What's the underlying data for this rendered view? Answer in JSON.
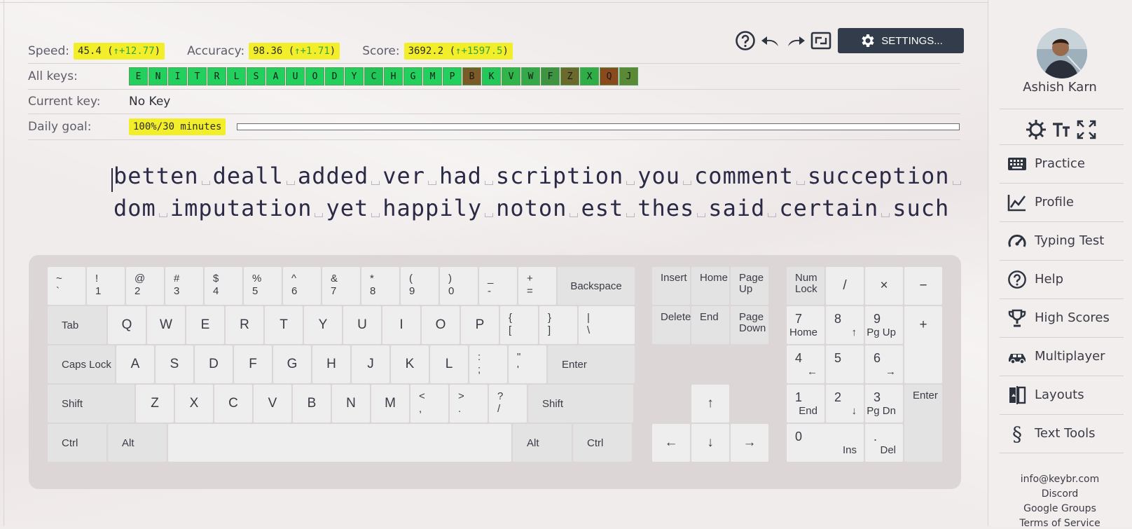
{
  "stats": {
    "speed_label": "Speed:",
    "speed_value": "45.4",
    "speed_delta": "+12.77",
    "accuracy_label": "Accuracy:",
    "accuracy_value": "98.36",
    "accuracy_delta": "+1.71",
    "score_label": "Score:",
    "score_value": "3692.2",
    "score_delta": "+1597.5"
  },
  "toolbar": {
    "help_icon": "help-circle-icon",
    "undo_icon": "undo-icon",
    "redo_icon": "redo-icon",
    "fullscreen_icon": "window-icon",
    "settings_label": "SETTINGS..."
  },
  "all_keys": {
    "label": "All keys:",
    "keys": [
      {
        "k": "E",
        "color": "#22d05e"
      },
      {
        "k": "N",
        "color": "#22d05e"
      },
      {
        "k": "I",
        "color": "#22d05e"
      },
      {
        "k": "T",
        "color": "#22d05e"
      },
      {
        "k": "R",
        "color": "#22d05e"
      },
      {
        "k": "L",
        "color": "#22d05e"
      },
      {
        "k": "S",
        "color": "#22d05e"
      },
      {
        "k": "A",
        "color": "#22d05e"
      },
      {
        "k": "U",
        "color": "#22d05e"
      },
      {
        "k": "O",
        "color": "#22d05e"
      },
      {
        "k": "D",
        "color": "#22d05e"
      },
      {
        "k": "Y",
        "color": "#22d05e"
      },
      {
        "k": "C",
        "color": "#1fc556"
      },
      {
        "k": "H",
        "color": "#22cf5a"
      },
      {
        "k": "G",
        "color": "#22d05e"
      },
      {
        "k": "M",
        "color": "#22d05e"
      },
      {
        "k": "P",
        "color": "#22d05e"
      },
      {
        "k": "B",
        "color": "#7a5a26"
      },
      {
        "k": "K",
        "color": "#22c85a"
      },
      {
        "k": "V",
        "color": "#2fb54a"
      },
      {
        "k": "W",
        "color": "#33a949"
      },
      {
        "k": "F",
        "color": "#3f9441"
      },
      {
        "k": "Z",
        "color": "#6b6a2c"
      },
      {
        "k": "X",
        "color": "#2fae47"
      },
      {
        "k": "Q",
        "color": "#8a4a1e"
      },
      {
        "k": "J",
        "color": "#5a8a35"
      }
    ]
  },
  "current_key": {
    "label": "Current key:",
    "value": "No Key"
  },
  "daily_goal": {
    "label": "Daily goal:",
    "value": "100%/30 minutes",
    "progress": 1.0
  },
  "lesson": {
    "line1": [
      "betten",
      "deall",
      "added",
      "ver",
      "had",
      "scription",
      "you",
      "comment",
      "sucception",
      ""
    ],
    "line2": [
      "dom",
      "imputation",
      "yet",
      "happily",
      "noton",
      "est",
      "thes",
      "said",
      "certain",
      "such"
    ]
  },
  "keyboard": {
    "row1": [
      [
        "~",
        "`"
      ],
      [
        "!",
        "1"
      ],
      [
        "@",
        "2"
      ],
      [
        "#",
        "3"
      ],
      [
        "$",
        "4"
      ],
      [
        "%",
        "5"
      ],
      [
        "^",
        "6"
      ],
      [
        "&",
        "7"
      ],
      [
        "*",
        "8"
      ],
      [
        "(",
        "9"
      ],
      [
        ")",
        "0"
      ],
      [
        "_",
        "-"
      ],
      [
        "+",
        "="
      ]
    ],
    "backspace": "Backspace",
    "tab": "Tab",
    "row2": [
      "Q",
      "W",
      "E",
      "R",
      "T",
      "Y",
      "U",
      "I",
      "O",
      "P"
    ],
    "row2_sym": [
      [
        "{",
        "["
      ],
      [
        "}",
        "]"
      ],
      [
        "|",
        "\\"
      ]
    ],
    "capslock": "Caps Lock",
    "row3": [
      "A",
      "S",
      "D",
      "F",
      "G",
      "H",
      "J",
      "K",
      "L"
    ],
    "row3_sym": [
      [
        ":",
        ";"
      ],
      [
        "\"",
        "'"
      ]
    ],
    "enter": "Enter",
    "shift": "Shift",
    "row4": [
      "Z",
      "X",
      "C",
      "V",
      "B",
      "N",
      "M"
    ],
    "row4_sym": [
      [
        "<",
        ","
      ],
      [
        ">",
        "."
      ],
      [
        "?",
        "/"
      ]
    ],
    "ctrl": "Ctrl",
    "alt": "Alt",
    "nav": {
      "insert": "Insert",
      "home": "Home",
      "pageup": "Page Up",
      "delete": "Delete",
      "end": "End",
      "pagedown": "Page Down"
    },
    "arrows": {
      "up": "↑",
      "down": "↓",
      "left": "←",
      "right": "→"
    },
    "numpad": {
      "numlock": "Num Lock",
      "div": "/",
      "mul": "×",
      "minus": "−",
      "plus": "+",
      "enter": "Enter",
      "n7": "7",
      "n7b": "Home",
      "n8": "8",
      "n8b": "↑",
      "n9": "9",
      "n9b": "Pg Up",
      "n4": "4",
      "n4b": "←",
      "n5": "5",
      "n6": "6",
      "n6b": "→",
      "n1": "1",
      "n1b": "End",
      "n2": "2",
      "n2b": "↓",
      "n3": "3",
      "n3b": "Pg Dn",
      "n0": "0",
      "n0b": "Ins",
      "dot": ".",
      "dotb": "Del"
    }
  },
  "sidebar": {
    "user_name": "Ashish Karn",
    "nav": [
      {
        "label": "Practice",
        "icon": "keyboard-icon"
      },
      {
        "label": "Profile",
        "icon": "chart-line-icon"
      },
      {
        "label": "Typing Test",
        "icon": "speedometer-icon"
      },
      {
        "label": "Help",
        "icon": "help-circle-icon"
      },
      {
        "label": "High Scores",
        "icon": "trophy-icon"
      },
      {
        "label": "Multiplayer",
        "icon": "car-icon"
      },
      {
        "label": "Layouts",
        "icon": "layouts-icon"
      },
      {
        "label": "Text Tools",
        "icon": "section-icon"
      }
    ],
    "footer": [
      "info@keybr.com",
      "Discord",
      "Google Groups",
      "Terms of Service"
    ]
  }
}
